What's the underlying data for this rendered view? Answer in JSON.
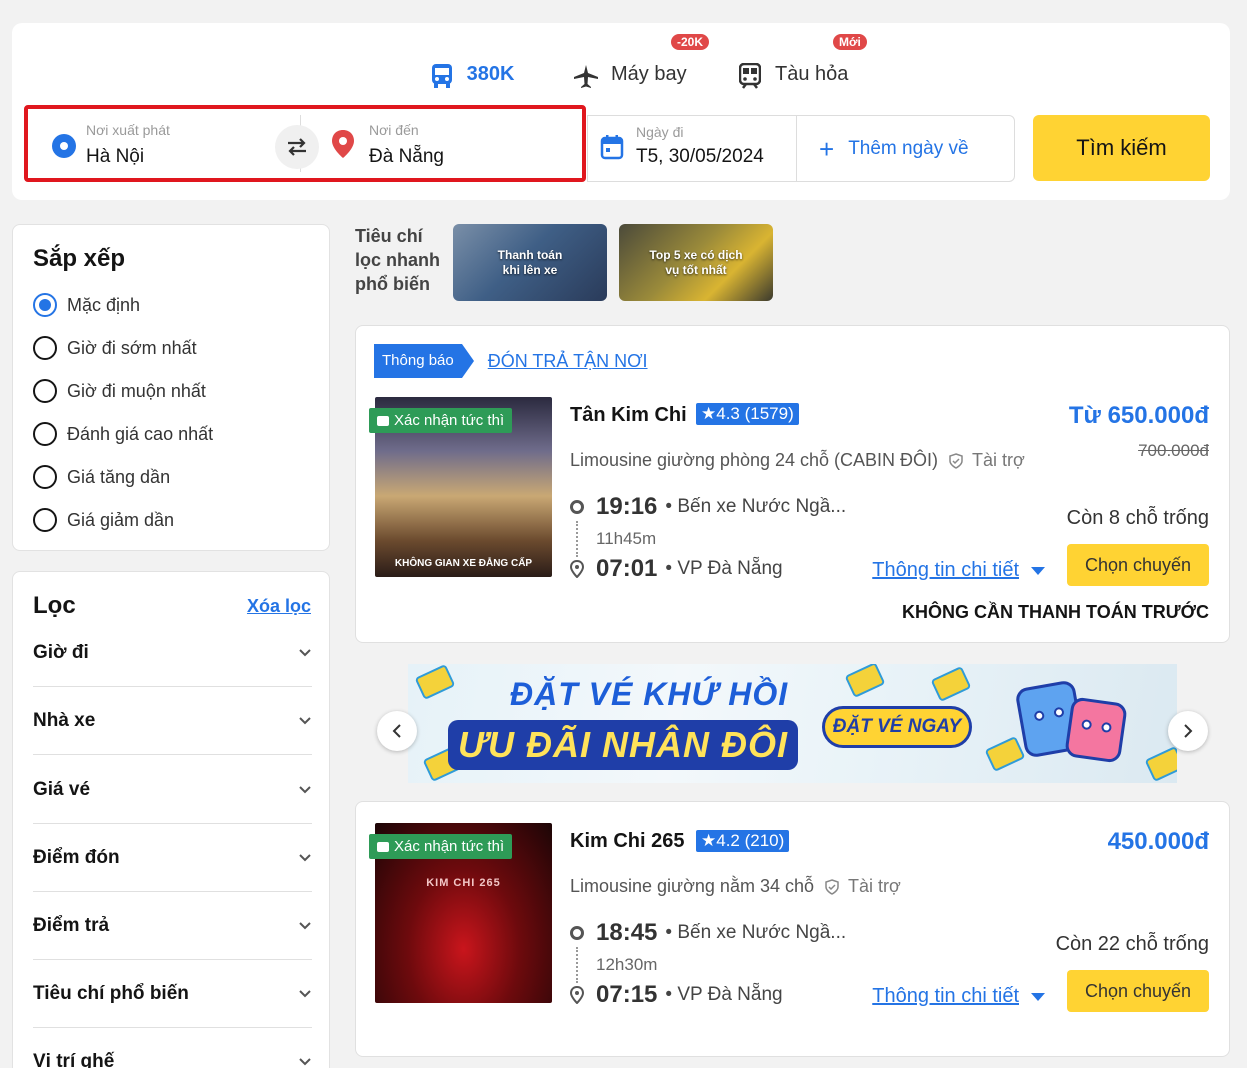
{
  "tabs": [
    {
      "label": "380K",
      "active": true,
      "icon": "bus-icon"
    },
    {
      "label": "Máy bay",
      "badge": "-20K",
      "icon": "airplane-icon"
    },
    {
      "label": "Tàu hỏa",
      "badge": "Mới",
      "icon": "train-icon"
    }
  ],
  "search": {
    "origin_label": "Nơi xuất phát",
    "origin_value": "Hà Nội",
    "dest_label": "Nơi đến",
    "dest_value": "Đà Nẵng",
    "date_label": "Ngày đi",
    "date_value": "T5, 30/05/2024",
    "return_label": "Thêm ngày về",
    "button_label": "Tìm kiếm"
  },
  "sort": {
    "title": "Sắp xếp",
    "options": [
      "Mặc định",
      "Giờ đi sớm nhất",
      "Giờ đi muộn nhất",
      "Đánh giá cao nhất",
      "Giá tăng dần",
      "Giá giảm dần"
    ],
    "selected": 0
  },
  "filter": {
    "title": "Lọc",
    "clear_label": "Xóa lọc",
    "items": [
      "Giờ đi",
      "Nhà xe",
      "Giá vé",
      "Điểm đón",
      "Điểm trả",
      "Tiêu chí phổ biến",
      "Vị trí ghế"
    ]
  },
  "quick_filters": {
    "title": "Tiêu chí lọc nhanh phổ biến",
    "items": [
      "Thanh toán khi lên xe",
      "Top 5 xe có dịch vụ tốt nhất"
    ]
  },
  "trips": [
    {
      "notice_tag": "Thông báo",
      "notice_link": "ĐÓN TRẢ TẬN NƠI",
      "confirm_badge": "Xác nhận tức thì",
      "image_text": "KHÔNG GIAN XE ĐẲNG CẤP",
      "operator": "Tân Kim Chi",
      "rating": "4.3 (1579)",
      "bus_type": "Limousine giường phòng 24 chỗ (CABIN ĐÔI)",
      "sponsor": "Tài trợ",
      "depart_time": "19:16",
      "depart_place": "Bến xe Nước Ngầ...",
      "duration": "11h45m",
      "arrive_time": "07:01",
      "arrive_place": "VP Đà Nẵng",
      "price": "Từ 650.000đ",
      "old_price": "700.000đ",
      "seats": "Còn 8 chỗ trống",
      "details_label": "Thông tin chi tiết",
      "choose_label": "Chọn chuyến",
      "no_prepay": "KHÔNG CẦN THANH TOÁN TRƯỚC"
    },
    {
      "confirm_badge": "Xác nhận tức thì",
      "image_text": "KIM CHI 265",
      "operator": "Kim Chi 265",
      "rating": "4.2 (210)",
      "bus_type": "Limousine giường nằm 34 chỗ",
      "sponsor": "Tài trợ",
      "depart_time": "18:45",
      "depart_place": "Bến xe Nước Ngầ...",
      "duration": "12h30m",
      "arrive_time": "07:15",
      "arrive_place": "VP Đà Nẵng",
      "price": "450.000đ",
      "seats": "Còn 22 chỗ trống",
      "details_label": "Thông tin chi tiết",
      "choose_label": "Chọn chuyến"
    }
  ],
  "banner": {
    "line1": "ĐẶT VÉ KHỨ HỒI",
    "line2": "ƯU ĐÃI NHÂN ĐÔI",
    "cta": "ĐẶT VÉ NGAY"
  },
  "colors": {
    "accent": "#2474e5",
    "cta_yellow": "#ffd333",
    "highlight_red": "#e0171e",
    "confirm_green": "#2e9b57"
  }
}
